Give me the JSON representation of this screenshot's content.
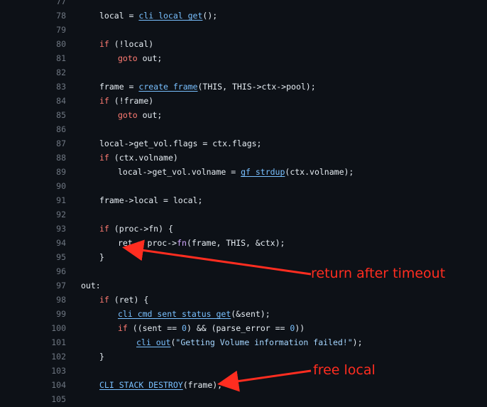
{
  "lines": [
    {
      "n": "77",
      "indent": 0,
      "tokens": []
    },
    {
      "n": "78",
      "indent": 1,
      "tokens": [
        [
          "plain",
          "local = "
        ],
        [
          "ul",
          "cli_local_get"
        ],
        [
          "plain",
          "();"
        ]
      ]
    },
    {
      "n": "79",
      "indent": 0,
      "tokens": []
    },
    {
      "n": "80",
      "indent": 1,
      "tokens": [
        [
          "kw",
          "if"
        ],
        [
          "plain",
          " (!local)"
        ]
      ]
    },
    {
      "n": "81",
      "indent": 2,
      "tokens": [
        [
          "kw",
          "goto"
        ],
        [
          "plain",
          " out;"
        ]
      ]
    },
    {
      "n": "82",
      "indent": 0,
      "tokens": []
    },
    {
      "n": "83",
      "indent": 1,
      "tokens": [
        [
          "plain",
          "frame = "
        ],
        [
          "ul",
          "create_frame"
        ],
        [
          "plain",
          "(THIS, THIS->ctx->pool);"
        ]
      ]
    },
    {
      "n": "84",
      "indent": 1,
      "tokens": [
        [
          "kw",
          "if"
        ],
        [
          "plain",
          " (!frame)"
        ]
      ]
    },
    {
      "n": "85",
      "indent": 2,
      "tokens": [
        [
          "kw",
          "goto"
        ],
        [
          "plain",
          " out;"
        ]
      ]
    },
    {
      "n": "86",
      "indent": 0,
      "tokens": []
    },
    {
      "n": "87",
      "indent": 1,
      "tokens": [
        [
          "plain",
          "local->get_vol.flags = ctx.flags;"
        ]
      ]
    },
    {
      "n": "88",
      "indent": 1,
      "tokens": [
        [
          "kw",
          "if"
        ],
        [
          "plain",
          " (ctx.volname)"
        ]
      ]
    },
    {
      "n": "89",
      "indent": 2,
      "tokens": [
        [
          "plain",
          "local->get_vol.volname = "
        ],
        [
          "ul",
          "gf_strdup"
        ],
        [
          "plain",
          "(ctx.volname);"
        ]
      ]
    },
    {
      "n": "90",
      "indent": 0,
      "tokens": []
    },
    {
      "n": "91",
      "indent": 1,
      "tokens": [
        [
          "plain",
          "frame->local = local;"
        ]
      ]
    },
    {
      "n": "92",
      "indent": 0,
      "tokens": []
    },
    {
      "n": "93",
      "indent": 1,
      "tokens": [
        [
          "kw",
          "if"
        ],
        [
          "plain",
          " (proc->fn) {"
        ]
      ]
    },
    {
      "n": "94",
      "indent": 2,
      "tokens": [
        [
          "plain",
          "ret = proc->"
        ],
        [
          "fn",
          "fn"
        ],
        [
          "plain",
          "(frame, THIS, &ctx);"
        ]
      ]
    },
    {
      "n": "95",
      "indent": 1,
      "tokens": [
        [
          "plain",
          "}"
        ]
      ]
    },
    {
      "n": "96",
      "indent": 0,
      "tokens": []
    },
    {
      "n": "97",
      "indent": 0,
      "tokens": [
        [
          "plain",
          "out:"
        ]
      ]
    },
    {
      "n": "98",
      "indent": 1,
      "tokens": [
        [
          "kw",
          "if"
        ],
        [
          "plain",
          " (ret) {"
        ]
      ]
    },
    {
      "n": "99",
      "indent": 2,
      "tokens": [
        [
          "ul",
          "cli_cmd_sent_status_get"
        ],
        [
          "plain",
          "(&sent);"
        ]
      ]
    },
    {
      "n": "100",
      "indent": 2,
      "tokens": [
        [
          "kw",
          "if"
        ],
        [
          "plain",
          " ((sent == "
        ],
        [
          "num",
          "0"
        ],
        [
          "plain",
          ") && (parse_error == "
        ],
        [
          "num",
          "0"
        ],
        [
          "plain",
          "))"
        ]
      ]
    },
    {
      "n": "101",
      "indent": 3,
      "tokens": [
        [
          "ul",
          "cli_out"
        ],
        [
          "plain",
          "("
        ],
        [
          "str",
          "\"Getting Volume information failed!\""
        ],
        [
          "plain",
          ");"
        ]
      ]
    },
    {
      "n": "102",
      "indent": 1,
      "tokens": [
        [
          "plain",
          "}"
        ]
      ]
    },
    {
      "n": "103",
      "indent": 0,
      "tokens": []
    },
    {
      "n": "104",
      "indent": 1,
      "tokens": [
        [
          "ul",
          "CLI_STACK_DESTROY"
        ],
        [
          "plain",
          "(frame);"
        ]
      ]
    },
    {
      "n": "105",
      "indent": 0,
      "tokens": []
    }
  ],
  "annotations": {
    "timeout": "return after timeout",
    "free": "free local"
  },
  "colors": {
    "background": "#0d1117",
    "line_number": "#6e7681",
    "text": "#e6edf3",
    "keyword": "#ff7b72",
    "function": "#79c0ff",
    "string": "#a5d6ff",
    "annotation": "#ff2d20"
  }
}
